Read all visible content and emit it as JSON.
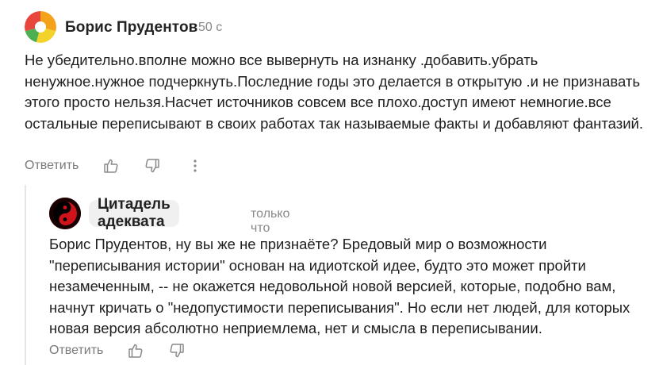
{
  "comments": [
    {
      "author": "Борис Прудентов",
      "time": "50 с",
      "text": "Не убедительно.вполне можно все вывернуть на изнанку .добавить.убрать ненужное.нужное подчеркнуть.Последние годы это делается в открытую .и не признавать этого просто нельзя.Насчет источников совсем все плохо.доступ имеют немногие.все остальные переписывают в своих работах так называемые факты и добавляют фантазий.",
      "reply_label": "Ответить",
      "avatar_icon": "multicolor-circle-avatar"
    },
    {
      "author": "Цитадель адеквата",
      "time": "только что",
      "text": "Борис Прудентов, ну вы же не признаёте? Бредовый мир о возможности \"переписывания истории\" основан на идиотской идее, будто это может пройти незамеченным, -- не окажется недовольной новой версией, которые, подобно вам, начнут кричать о \"недопустимости переписывания\". Но если нет людей, для которых новая версия абсолютно неприемлема, нет и смысла в переписывании.",
      "reply_label": "Ответить",
      "avatar_icon": "red-yin-yang-avatar"
    }
  ],
  "icons": {
    "like": "thumbs-up-icon",
    "dislike": "thumbs-down-icon",
    "more": "vertical-dots-icon"
  },
  "colors": {
    "muted_text": "#7a7a7a",
    "name_pill_bg": "#f0f0f0",
    "thread_line": "#e6e6e6"
  }
}
